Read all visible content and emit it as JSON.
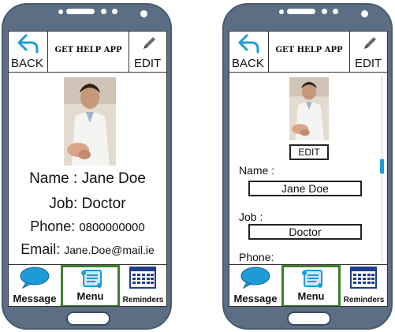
{
  "app": {
    "title": "GET HELP APP"
  },
  "header": {
    "back_label": "BACK",
    "edit_label": "EDIT"
  },
  "profile_view": {
    "name_line": "Name : Jane Doe",
    "job_line": "Job: Doctor",
    "phone_label": "Phone: ",
    "phone_value": "0800000000",
    "email_label": "Email: ",
    "email_value": "Jane.Doe@mail.ie"
  },
  "profile_edit": {
    "edit_photo_label": "EDIT",
    "name_label": "Name :",
    "name_value": "Jane Doe",
    "job_label": "Job :",
    "job_value": "Doctor",
    "phone_label": "Phone:"
  },
  "footer": {
    "message_label": "Message",
    "menu_label": "Menu",
    "reminders_label": "Reminders"
  },
  "icons": {
    "back": "back-arrow-icon",
    "edit": "pencil-icon",
    "message": "speech-bubble-icon",
    "menu": "scroll-icon",
    "reminders": "calendar-icon"
  },
  "colors": {
    "phone_body": "#5b6e84",
    "menu_highlight": "#3c7f2c",
    "icon_blue": "#1e9bd7",
    "calendar_blue": "#1f3d8f"
  }
}
